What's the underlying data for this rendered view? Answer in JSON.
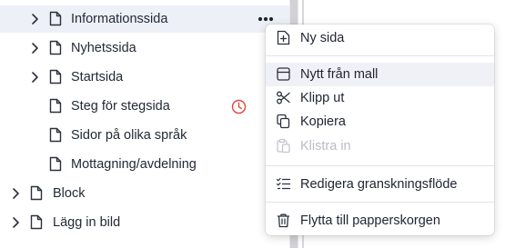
{
  "tree": {
    "items": [
      {
        "label": "Informationssida"
      },
      {
        "label": "Nyhetssida"
      },
      {
        "label": "Startsida"
      },
      {
        "label": "Steg för stegsida"
      },
      {
        "label": "Sidor på olika språk"
      },
      {
        "label": "Mottagning/avdelning"
      },
      {
        "label": "Block"
      },
      {
        "label": "Lägg in bild"
      }
    ],
    "more_icon": "more-horizontal-icon",
    "status_icon": "clock-icon",
    "status_color": "#e0453a"
  },
  "context_menu": {
    "items": [
      {
        "label": "Ny sida",
        "icon": "file-plus-icon"
      },
      {
        "label": "Nytt från mall",
        "icon": "template-icon"
      },
      {
        "label": "Klipp ut",
        "icon": "scissors-icon"
      },
      {
        "label": "Kopiera",
        "icon": "copy-icon"
      },
      {
        "label": "Klistra in",
        "icon": "paste-icon",
        "disabled": true
      },
      {
        "label": "Redigera granskningsflöde",
        "icon": "checklist-icon"
      },
      {
        "label": "Flytta till papperskorgen",
        "icon": "trash-icon"
      }
    ]
  }
}
